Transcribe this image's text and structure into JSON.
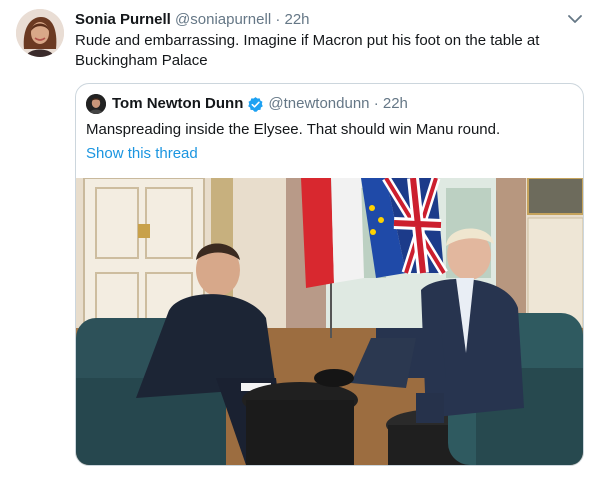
{
  "tweet": {
    "author_name": "Sonia Purnell",
    "author_handle": "@soniapurnell",
    "separator": "·",
    "time": "22h",
    "text": "Rude and embarrassing. Imagine if Macron put his foot on the table at Buckingham Palace"
  },
  "quoted": {
    "author_name": "Tom Newton Dunn",
    "author_handle": "@tnewtondunn",
    "separator": "·",
    "time": "22h",
    "text": "Manspreading inside the Elysee. That should win Manu round.",
    "show_thread": "Show this thread"
  },
  "icons": {
    "menu": "chevron-down-icon",
    "verified": "verified-badge-icon"
  },
  "colors": {
    "link": "#1b95e0",
    "secondary_text": "#657786",
    "verified_badge": "#1da1f2",
    "border": "#ccd6dd"
  }
}
